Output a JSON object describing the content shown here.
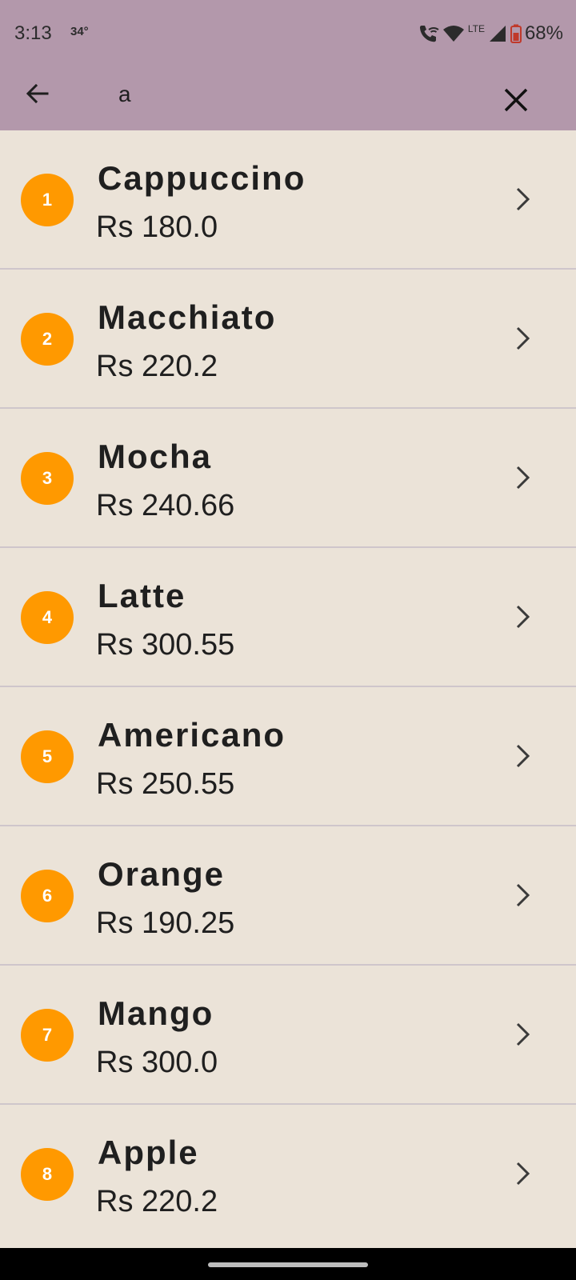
{
  "status_bar": {
    "time": "3:13",
    "temperature": "34°",
    "network": "LTE",
    "battery": "68%",
    "icons": [
      "wifi-calling-icon",
      "wifi-icon",
      "signal-icon",
      "battery-icon"
    ]
  },
  "toolbar": {
    "search_value": "a",
    "back_icon": "arrow-back-icon",
    "close_icon": "close-icon"
  },
  "items": [
    {
      "number": "1",
      "name": "Cappuccino",
      "price": "Rs 180.0"
    },
    {
      "number": "2",
      "name": "Macchiato",
      "price": "Rs 220.2"
    },
    {
      "number": "3",
      "name": "Mocha",
      "price": "Rs 240.66"
    },
    {
      "number": "4",
      "name": "Latte",
      "price": "Rs 300.55"
    },
    {
      "number": "5",
      "name": "Americano",
      "price": "Rs 250.55"
    },
    {
      "number": "6",
      "name": "Orange",
      "price": "Rs 190.25"
    },
    {
      "number": "7",
      "name": "Mango",
      "price": "Rs 300.0"
    },
    {
      "number": "8",
      "name": "Apple",
      "price": "Rs 220.2"
    }
  ],
  "colors": {
    "app_bar": "#b398ab",
    "background": "#ebe3d8",
    "badge": "#ff9900",
    "divider": "#cfc6cb"
  }
}
